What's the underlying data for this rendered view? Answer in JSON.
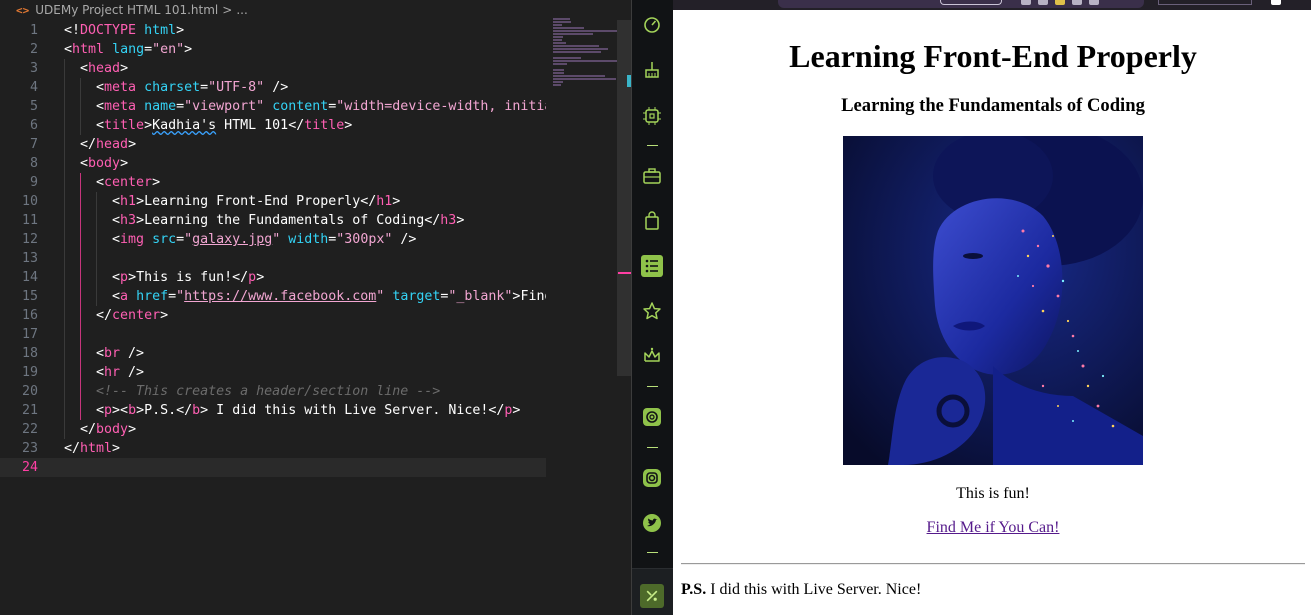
{
  "editor": {
    "breadcrumb": {
      "icon": "<>",
      "file": "UDEMy Project HTML 101.html",
      "sep": ">",
      "trail": "..."
    },
    "lines": [
      {
        "n": "1",
        "parts": [
          [
            "punct",
            "<!"
          ],
          [
            "tag",
            "DOCTYPE"
          ],
          [
            "punct",
            " "
          ],
          [
            "attr",
            "html"
          ],
          [
            "punct",
            ">"
          ]
        ]
      },
      {
        "n": "2",
        "parts": [
          [
            "punct",
            "<"
          ],
          [
            "tag",
            "html"
          ],
          [
            "punct",
            " "
          ],
          [
            "attr",
            "lang"
          ],
          [
            "punct",
            "="
          ],
          [
            "str",
            "\"en\""
          ],
          [
            "punct",
            ">"
          ]
        ]
      },
      {
        "n": "3",
        "parts": [
          [
            "punct",
            "  <"
          ],
          [
            "tag",
            "head"
          ],
          [
            "punct",
            ">"
          ]
        ]
      },
      {
        "n": "4",
        "parts": [
          [
            "punct",
            "    <"
          ],
          [
            "tag",
            "meta"
          ],
          [
            "punct",
            " "
          ],
          [
            "attr",
            "charset"
          ],
          [
            "punct",
            "="
          ],
          [
            "str",
            "\"UTF-8\""
          ],
          [
            "punct",
            " />"
          ]
        ]
      },
      {
        "n": "5",
        "parts": [
          [
            "punct",
            "    <"
          ],
          [
            "tag",
            "meta"
          ],
          [
            "punct",
            " "
          ],
          [
            "attr",
            "name"
          ],
          [
            "punct",
            "="
          ],
          [
            "str",
            "\"viewport\""
          ],
          [
            "punct",
            " "
          ],
          [
            "attr",
            "content"
          ],
          [
            "punct",
            "="
          ],
          [
            "str",
            "\"width=device-width, initial-"
          ]
        ]
      },
      {
        "n": "6",
        "parts": [
          [
            "punct",
            "    <"
          ],
          [
            "tag",
            "title"
          ],
          [
            "punct",
            ">"
          ],
          [
            "squig",
            "Kadhia's"
          ],
          [
            "text",
            " HTML 101"
          ],
          [
            "punct",
            "</"
          ],
          [
            "tag",
            "title"
          ],
          [
            "punct",
            ">"
          ]
        ]
      },
      {
        "n": "7",
        "parts": [
          [
            "punct",
            "  </"
          ],
          [
            "tag",
            "head"
          ],
          [
            "punct",
            ">"
          ]
        ]
      },
      {
        "n": "8",
        "parts": [
          [
            "punct",
            "  <"
          ],
          [
            "tag",
            "body"
          ],
          [
            "punct",
            ">"
          ]
        ]
      },
      {
        "n": "9",
        "parts": [
          [
            "punct",
            "    <"
          ],
          [
            "tag",
            "center"
          ],
          [
            "punct",
            ">"
          ]
        ]
      },
      {
        "n": "10",
        "parts": [
          [
            "punct",
            "      <"
          ],
          [
            "tag",
            "h1"
          ],
          [
            "punct",
            ">"
          ],
          [
            "text",
            "Learning Front-End Properly"
          ],
          [
            "punct",
            "</"
          ],
          [
            "tag",
            "h1"
          ],
          [
            "punct",
            ">"
          ]
        ]
      },
      {
        "n": "11",
        "parts": [
          [
            "punct",
            "      <"
          ],
          [
            "tag",
            "h3"
          ],
          [
            "punct",
            ">"
          ],
          [
            "text",
            "Learning the Fundamentals of Coding"
          ],
          [
            "punct",
            "</"
          ],
          [
            "tag",
            "h3"
          ],
          [
            "punct",
            ">"
          ]
        ]
      },
      {
        "n": "12",
        "parts": [
          [
            "punct",
            "      <"
          ],
          [
            "tag",
            "img"
          ],
          [
            "punct",
            " "
          ],
          [
            "attr",
            "src"
          ],
          [
            "punct",
            "="
          ],
          [
            "str",
            "\""
          ],
          [
            "link",
            "galaxy.jpg"
          ],
          [
            "str",
            "\""
          ],
          [
            "punct",
            " "
          ],
          [
            "attr",
            "width"
          ],
          [
            "punct",
            "="
          ],
          [
            "str",
            "\"300px\""
          ],
          [
            "punct",
            " />"
          ]
        ]
      },
      {
        "n": "13",
        "parts": []
      },
      {
        "n": "14",
        "parts": [
          [
            "punct",
            "      <"
          ],
          [
            "tag",
            "p"
          ],
          [
            "punct",
            ">"
          ],
          [
            "text",
            "This is fun!"
          ],
          [
            "punct",
            "</"
          ],
          [
            "tag",
            "p"
          ],
          [
            "punct",
            ">"
          ]
        ]
      },
      {
        "n": "15",
        "parts": [
          [
            "punct",
            "      <"
          ],
          [
            "tag",
            "a"
          ],
          [
            "punct",
            " "
          ],
          [
            "attr",
            "href"
          ],
          [
            "punct",
            "="
          ],
          [
            "str",
            "\""
          ],
          [
            "link",
            "https://www.facebook.com"
          ],
          [
            "str",
            "\""
          ],
          [
            "punct",
            " "
          ],
          [
            "attr",
            "target"
          ],
          [
            "punct",
            "="
          ],
          [
            "str",
            "\"_blank\""
          ],
          [
            "punct",
            ">"
          ],
          [
            "text",
            "Find M"
          ]
        ]
      },
      {
        "n": "16",
        "parts": [
          [
            "punct",
            "    </"
          ],
          [
            "tag",
            "center"
          ],
          [
            "punct",
            ">"
          ]
        ]
      },
      {
        "n": "17",
        "parts": []
      },
      {
        "n": "18",
        "parts": [
          [
            "punct",
            "    <"
          ],
          [
            "tag",
            "br"
          ],
          [
            "punct",
            " />"
          ]
        ]
      },
      {
        "n": "19",
        "parts": [
          [
            "punct",
            "    <"
          ],
          [
            "tag",
            "hr"
          ],
          [
            "punct",
            " />"
          ]
        ]
      },
      {
        "n": "20",
        "parts": [
          [
            "comment",
            "    <!-- This creates a header/section line -->"
          ]
        ]
      },
      {
        "n": "21",
        "parts": [
          [
            "punct",
            "    <"
          ],
          [
            "tag",
            "p"
          ],
          [
            "punct",
            "><"
          ],
          [
            "tag",
            "b"
          ],
          [
            "punct",
            ">"
          ],
          [
            "text",
            "P.S."
          ],
          [
            "punct",
            "</"
          ],
          [
            "tag",
            "b"
          ],
          [
            "punct",
            ">"
          ],
          [
            "text",
            " I did this with Live Server. Nice!"
          ],
          [
            "punct",
            "</"
          ],
          [
            "tag",
            "p"
          ],
          [
            "punct",
            ">"
          ]
        ]
      },
      {
        "n": "22",
        "parts": [
          [
            "punct",
            "  </"
          ],
          [
            "tag",
            "body"
          ],
          [
            "punct",
            ">"
          ]
        ]
      },
      {
        "n": "23",
        "parts": [
          [
            "punct",
            "</"
          ],
          [
            "tag",
            "html"
          ],
          [
            "punct",
            ">"
          ]
        ]
      },
      {
        "n": "24",
        "parts": []
      }
    ],
    "current_line": "24"
  },
  "sidebar": {
    "icons": [
      "speedometer-icon",
      "broom-icon",
      "cpu-chip-icon",
      "briefcase-icon",
      "shopping-bag-icon",
      "reading-list-icon",
      "star-icon",
      "crown-icon",
      "chatgpt-icon",
      "instagram-icon",
      "twitter-icon"
    ],
    "bottom_tool": "tool-settings-icon"
  },
  "page": {
    "h1": "Learning Front-End Properly",
    "h3": "Learning the Fundamentals of Coding",
    "image_alt": "galaxy.jpg",
    "p_fun": "This is fun!",
    "link_text": "Find Me if You Can!",
    "ps_bold": "P.S.",
    "ps_text": " I did this with Live Server. Nice!"
  },
  "colors": {
    "tag": "#ff5fb3",
    "attr": "#34d3f5",
    "string": "#f2a6d2",
    "accent_green": "#a4d45a",
    "link_visited": "#551a8b"
  }
}
